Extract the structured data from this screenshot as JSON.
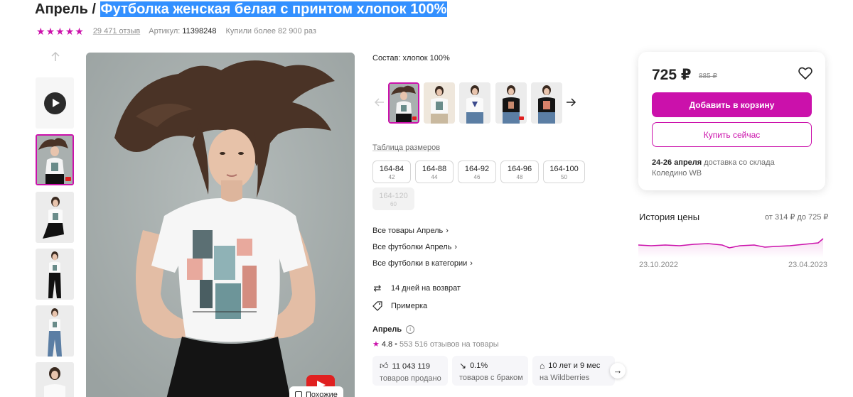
{
  "title": {
    "brand": "Апрель /",
    "product": "Футболка женская белая с принтом хлопок 100%"
  },
  "meta": {
    "rating_stars": 5,
    "reviews": "29 471 отзыв",
    "article_label": "Артикул:",
    "article": "11398248",
    "bought": "Купили более 82 900 раз"
  },
  "gallery": {
    "similar_label": "Похожие"
  },
  "composition": "Состав: хлопок 100%",
  "size_table_label": "Таблица размеров",
  "sizes": [
    {
      "size": "164-84",
      "ru": "42",
      "available": true
    },
    {
      "size": "164-88",
      "ru": "44",
      "available": true
    },
    {
      "size": "164-92",
      "ru": "46",
      "available": true
    },
    {
      "size": "164-96",
      "ru": "48",
      "available": true
    },
    {
      "size": "164-100",
      "ru": "50",
      "available": true
    },
    {
      "size": "164-120",
      "ru": "60",
      "available": false
    }
  ],
  "links": [
    "Все товары Апрель",
    "Все футболки Апрель",
    "Все футболки в категории"
  ],
  "features": {
    "return": "14 дней на возврат",
    "fitting": "Примерка"
  },
  "seller": {
    "name": "Апрель",
    "rating": "4.8",
    "reviews": "553 516 отзывов на товары",
    "stats": [
      {
        "value": "11 043 119",
        "label": "товаров продано",
        "icon": "thumbs-up-icon"
      },
      {
        "value": "0.1%",
        "label": "товаров с браком",
        "icon": "trend-down-icon"
      },
      {
        "value": "10 лет и 9 мес",
        "label": "на Wildberries",
        "icon": "shop-icon"
      }
    ]
  },
  "price_card": {
    "price": "725 ₽",
    "old_price": "885 ₽",
    "add_to_cart": "Добавить в корзину",
    "buy_now": "Купить сейчас",
    "delivery_dates": "24-26 апреля",
    "delivery_text": "доставка со склада",
    "warehouse": "Коледино WB"
  },
  "price_history": {
    "title": "История цены",
    "range": "от 314 ₽ до 725 ₽",
    "start_date": "23.10.2022",
    "end_date": "23.04.2023"
  },
  "colors": {
    "accent": "#cb11ab",
    "text": "#242424",
    "selection": "#3390ff"
  }
}
